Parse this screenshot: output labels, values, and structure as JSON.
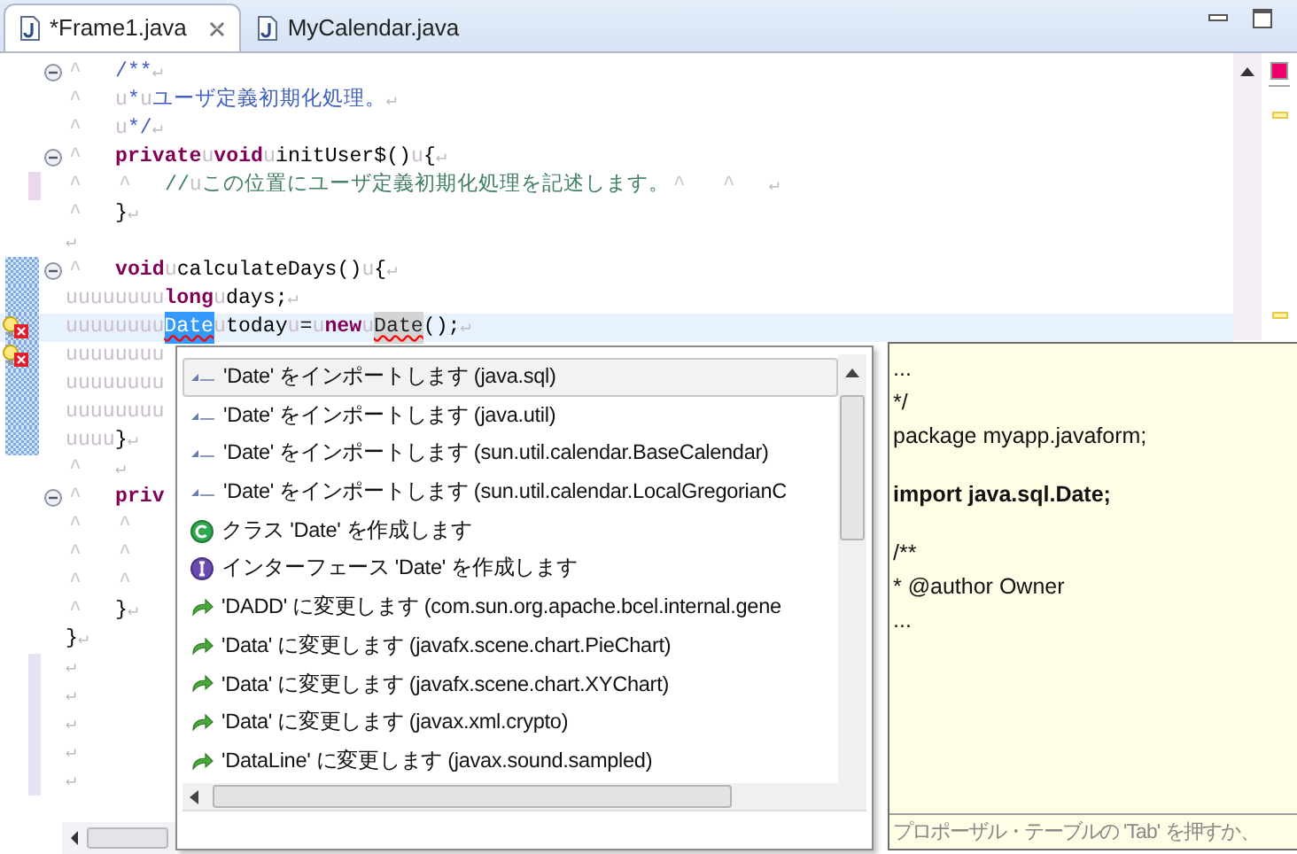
{
  "tabs": [
    {
      "label": "*Frame1.java",
      "selected": true,
      "closable": true
    },
    {
      "label": "MyCalendar.java",
      "selected": false,
      "closable": false
    }
  ],
  "editor": {
    "lines": [
      {
        "fold": true,
        "tokens": [
          {
            "kind": "tab",
            "text": "^"
          },
          {
            "kind": "javadoc",
            "text": "/**"
          },
          {
            "kind": "eol",
            "text": "↵"
          }
        ]
      },
      {
        "tokens": [
          {
            "kind": "tab",
            "text": "^"
          },
          {
            "kind": "ws",
            "text": "u"
          },
          {
            "kind": "javadoc",
            "text": "*"
          },
          {
            "kind": "ws",
            "text": "u"
          },
          {
            "kind": "javadoc",
            "text": "ユーザ定義初期化処理。"
          },
          {
            "kind": "eol",
            "text": "↵"
          }
        ]
      },
      {
        "tokens": [
          {
            "kind": "tab",
            "text": "^"
          },
          {
            "kind": "ws",
            "text": "u"
          },
          {
            "kind": "javadoc",
            "text": "*/"
          },
          {
            "kind": "eol",
            "text": "↵"
          }
        ]
      },
      {
        "fold": true,
        "tokens": [
          {
            "kind": "tab",
            "text": "^"
          },
          {
            "kind": "keyword",
            "text": "private"
          },
          {
            "kind": "ws",
            "text": "u"
          },
          {
            "kind": "keyword",
            "text": "void"
          },
          {
            "kind": "ws",
            "text": "u"
          },
          {
            "kind": "plain",
            "text": "initUser$()"
          },
          {
            "kind": "ws",
            "text": "u"
          },
          {
            "kind": "plain",
            "text": "{"
          },
          {
            "kind": "eol",
            "text": "↵"
          }
        ]
      },
      {
        "removed": true,
        "tokens": [
          {
            "kind": "tab",
            "text": "^"
          },
          {
            "kind": "tab",
            "text": "^"
          },
          {
            "kind": "comment",
            "text": "//"
          },
          {
            "kind": "ws",
            "text": "u"
          },
          {
            "kind": "comment",
            "text": "この位置にユーザ定義初期化処理を記述します。"
          },
          {
            "kind": "tab",
            "text": "^"
          },
          {
            "kind": "tab",
            "text": "^"
          },
          {
            "kind": "eol",
            "text": "↵"
          }
        ]
      },
      {
        "tokens": [
          {
            "kind": "tab",
            "text": "^"
          },
          {
            "kind": "plain",
            "text": "}"
          },
          {
            "kind": "eol",
            "text": "↵"
          }
        ]
      },
      {
        "tokens": [
          {
            "kind": "eol",
            "text": "↵"
          }
        ]
      },
      {
        "fold": true,
        "modified": true,
        "tokens": [
          {
            "kind": "tab",
            "text": "^"
          },
          {
            "kind": "keyword",
            "text": "void"
          },
          {
            "kind": "ws",
            "text": "u"
          },
          {
            "kind": "plain",
            "text": "calculateDays()"
          },
          {
            "kind": "ws",
            "text": "u"
          },
          {
            "kind": "plain",
            "text": "{"
          },
          {
            "kind": "eol",
            "text": "↵"
          }
        ]
      },
      {
        "modified": true,
        "tokens": [
          {
            "kind": "ws",
            "text": "uuuuuuuu"
          },
          {
            "kind": "keyword",
            "text": "long"
          },
          {
            "kind": "ws",
            "text": "u"
          },
          {
            "kind": "plain",
            "text": "days;"
          },
          {
            "kind": "eol",
            "text": "↵"
          }
        ]
      },
      {
        "modified": true,
        "current": true,
        "error": true,
        "tokens": [
          {
            "kind": "ws",
            "text": "uuuuuuuu"
          },
          {
            "kind": "selected_error",
            "text": "Date"
          },
          {
            "kind": "ws",
            "text": "u"
          },
          {
            "kind": "plain",
            "text": "today"
          },
          {
            "kind": "ws",
            "text": "u"
          },
          {
            "kind": "plain",
            "text": "="
          },
          {
            "kind": "ws",
            "text": "u"
          },
          {
            "kind": "keyword",
            "text": "new"
          },
          {
            "kind": "ws",
            "text": "u"
          },
          {
            "kind": "linked_error",
            "text": "Date"
          },
          {
            "kind": "plain",
            "text": "();"
          },
          {
            "kind": "eol",
            "text": "↵"
          }
        ]
      },
      {
        "modified": true,
        "error": true,
        "tokens": [
          {
            "kind": "ws",
            "text": "uuuuuuuu"
          }
        ]
      },
      {
        "modified": true,
        "tokens": [
          {
            "kind": "ws",
            "text": "uuuuuuuu"
          }
        ]
      },
      {
        "modified": true,
        "tokens": [
          {
            "kind": "ws",
            "text": "uuuuuuuu"
          }
        ]
      },
      {
        "modified": true,
        "tokens": [
          {
            "kind": "ws",
            "text": "uuuu"
          },
          {
            "kind": "plain",
            "text": "}"
          },
          {
            "kind": "eol",
            "text": "↵"
          }
        ]
      },
      {
        "tokens": [
          {
            "kind": "tab",
            "text": "^"
          },
          {
            "kind": "eol",
            "text": "↵"
          }
        ]
      },
      {
        "fold": true,
        "tokens": [
          {
            "kind": "tab",
            "text": "^"
          },
          {
            "kind": "keyword",
            "text": "priv"
          }
        ]
      },
      {
        "tokens": [
          {
            "kind": "tab",
            "text": "^"
          },
          {
            "kind": "tab",
            "text": "^"
          }
        ]
      },
      {
        "tokens": [
          {
            "kind": "tab",
            "text": "^"
          },
          {
            "kind": "tab",
            "text": "^"
          }
        ]
      },
      {
        "tokens": [
          {
            "kind": "tab",
            "text": "^"
          },
          {
            "kind": "tab",
            "text": "^"
          }
        ]
      },
      {
        "tokens": [
          {
            "kind": "tab",
            "text": "^"
          },
          {
            "kind": "plain",
            "text": "}"
          },
          {
            "kind": "eol",
            "text": "↵"
          }
        ]
      },
      {
        "tokens": [
          {
            "kind": "plain",
            "text": "}"
          },
          {
            "kind": "eol",
            "text": "↵"
          }
        ]
      },
      {
        "added": true,
        "tokens": [
          {
            "kind": "eol",
            "text": "↵"
          }
        ]
      },
      {
        "added": true,
        "tokens": [
          {
            "kind": "eol",
            "text": "↵"
          }
        ]
      },
      {
        "added": true,
        "tokens": [
          {
            "kind": "eol",
            "text": "↵"
          }
        ]
      },
      {
        "added": true,
        "tokens": [
          {
            "kind": "eol",
            "text": "↵"
          }
        ]
      },
      {
        "added": true,
        "tokens": [
          {
            "kind": "eol",
            "text": "↵"
          }
        ]
      }
    ],
    "overview_ruler": {
      "has_errors": true,
      "marks": [
        {
          "kind": "task"
        },
        {
          "kind": "task"
        }
      ]
    }
  },
  "proposals": {
    "items": [
      {
        "kind": "import",
        "label": "'Date' をインポートします (java.sql)",
        "selected": true
      },
      {
        "kind": "import",
        "label": "'Date' をインポートします (java.util)",
        "selected": false
      },
      {
        "kind": "import",
        "label": "'Date' をインポートします (sun.util.calendar.BaseCalendar)",
        "selected": false
      },
      {
        "kind": "import",
        "label": "'Date' をインポートします (sun.util.calendar.LocalGregorianC",
        "selected": false
      },
      {
        "kind": "class",
        "label": "クラス 'Date' を作成します",
        "selected": false
      },
      {
        "kind": "interface",
        "label": "インターフェース 'Date' を作成します",
        "selected": false
      },
      {
        "kind": "rename",
        "label": "'DADD' に変更します (com.sun.org.apache.bcel.internal.gene",
        "selected": false
      },
      {
        "kind": "rename",
        "label": "'Data' に変更します (javafx.scene.chart.PieChart)",
        "selected": false
      },
      {
        "kind": "rename",
        "label": "'Data' に変更します (javafx.scene.chart.XYChart)",
        "selected": false
      },
      {
        "kind": "rename",
        "label": "'Data' に変更します (javax.xml.crypto)",
        "selected": false
      },
      {
        "kind": "rename",
        "label": "'DataLine' に変更します (javax.sound.sampled)",
        "selected": false
      }
    ]
  },
  "preview": {
    "groups": [
      {
        "bold": false,
        "lines": [
          "...",
          "*/",
          "package myapp.javaform;"
        ]
      },
      {
        "bold": true,
        "lines": [
          "import java.sql.Date;"
        ]
      },
      {
        "bold": false,
        "lines": [
          "/**",
          "* @author Owner",
          "..."
        ]
      }
    ],
    "footer": "プロポーザル・テーブルの 'Tab' を押すか、"
  }
}
